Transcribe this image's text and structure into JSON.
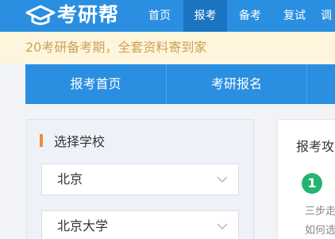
{
  "brand": {
    "name": "考研帮"
  },
  "nav": {
    "items": [
      {
        "label": "首页"
      },
      {
        "label": "报考",
        "active": true
      },
      {
        "label": "备考"
      },
      {
        "label": "复试"
      },
      {
        "label": "调"
      }
    ]
  },
  "notice": {
    "text": "20考研备考期，全套资料寄到家"
  },
  "tabs": [
    {
      "label": "报考首页"
    },
    {
      "label": "考研报名"
    }
  ],
  "school_selector": {
    "title": "选择学校",
    "region": "北京",
    "school": "北京大学"
  },
  "guide": {
    "title": "报考攻",
    "step_number": "1",
    "lines": [
      "三步走",
      "如何选"
    ]
  },
  "colors": {
    "brand_blue": "#2a8fe0",
    "active_blue": "#1a74c2",
    "notice_bg": "#fdf6dc",
    "notice_text": "#cfa05c",
    "accent_orange": "#f08a3a",
    "step_green": "#25b46e"
  },
  "icons": {
    "logo": "graduation-cap-icon",
    "select_arrow": "chevron-down-icon"
  }
}
